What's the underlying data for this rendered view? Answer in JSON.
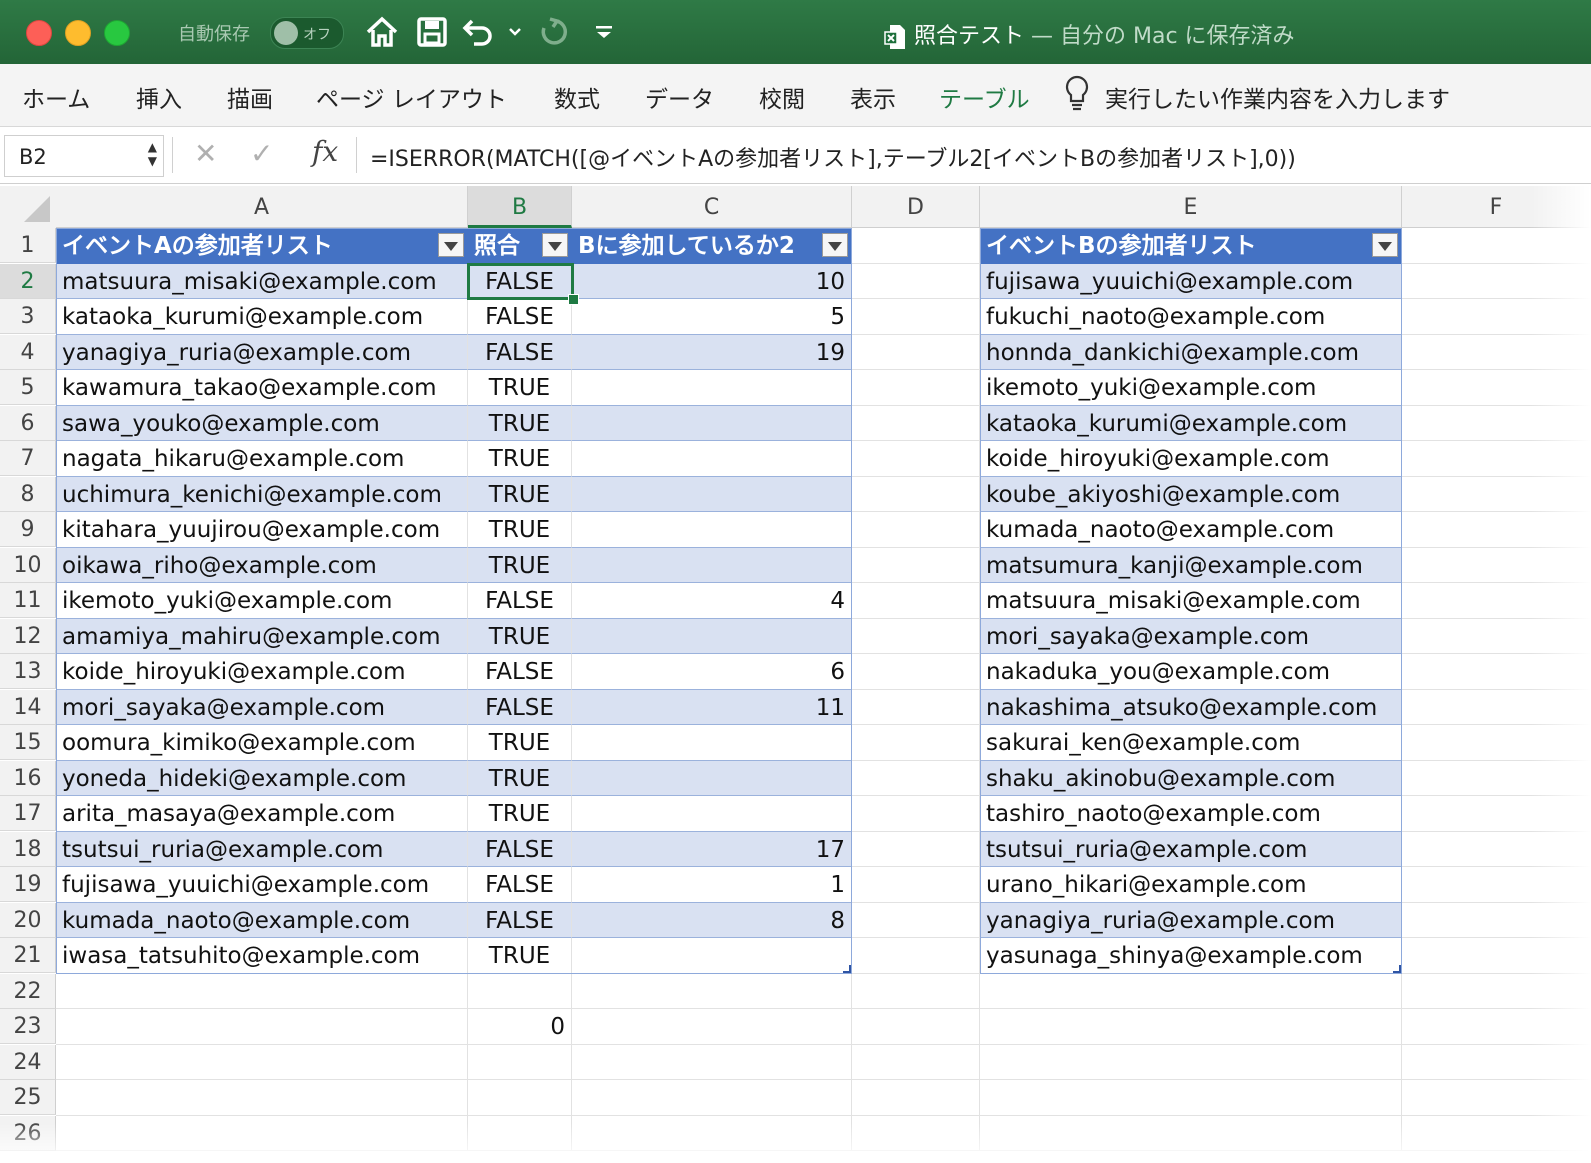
{
  "titlebar": {
    "autosave_label": "自動保存",
    "toggle_label": "オフ",
    "file_name": "照合テスト",
    "file_status": " — 自分の Mac に保存済み"
  },
  "ribbon": {
    "tabs": [
      "ホーム",
      "挿入",
      "描画",
      "ページ レイアウト",
      "数式",
      "データ",
      "校閲",
      "表示",
      "テーブル"
    ],
    "active_tab": "テーブル",
    "tell_me": "実行したい作業内容を入力します"
  },
  "formula_bar": {
    "name_box": "B2",
    "formula": "=ISERROR(MATCH([@イベントAの参加者リスト],テーブル2[イベントBの参加者リスト],0))"
  },
  "colors": {
    "excel_green": "#1f7a43",
    "table_header": "#4472c4",
    "table_band": "#d9e1f2"
  },
  "sheet": {
    "columns": [
      "A",
      "B",
      "C",
      "D",
      "E",
      "F"
    ],
    "selected_column": "B",
    "rows": [
      "1",
      "2",
      "3",
      "4",
      "5",
      "6",
      "7",
      "8",
      "9",
      "10",
      "11",
      "12",
      "13",
      "14",
      "15",
      "16",
      "17",
      "18",
      "19",
      "20",
      "21",
      "22",
      "23",
      "24",
      "25",
      "26"
    ],
    "selected_row": "2",
    "table1_headers": [
      "イベントAの参加者リスト",
      "照合",
      "Bに参加しているか2"
    ],
    "table2_header": "イベントBの参加者リスト",
    "colA": [
      "matsuura_misaki@example.com",
      "kataoka_kurumi@example.com",
      "yanagiya_ruria@example.com",
      "kawamura_takao@example.com",
      "sawa_youko@example.com",
      "nagata_hikaru@example.com",
      "uchimura_kenichi@example.com",
      "kitahara_yuujirou@example.com",
      "oikawa_riho@example.com",
      "ikemoto_yuki@example.com",
      "amamiya_mahiru@example.com",
      "koide_hiroyuki@example.com",
      "mori_sayaka@example.com",
      "oomura_kimiko@example.com",
      "yoneda_hideki@example.com",
      "arita_masaya@example.com",
      "tsutsui_ruria@example.com",
      "fujisawa_yuuichi@example.com",
      "kumada_naoto@example.com",
      "iwasa_tatsuhito@example.com"
    ],
    "colB": [
      "FALSE",
      "FALSE",
      "FALSE",
      "TRUE",
      "TRUE",
      "TRUE",
      "TRUE",
      "TRUE",
      "TRUE",
      "FALSE",
      "TRUE",
      "FALSE",
      "FALSE",
      "TRUE",
      "TRUE",
      "TRUE",
      "FALSE",
      "FALSE",
      "FALSE",
      "TRUE"
    ],
    "colC": [
      "10",
      "5",
      "19",
      "",
      "",
      "",
      "",
      "",
      "",
      "4",
      "",
      "6",
      "11",
      "",
      "",
      "",
      "17",
      "1",
      "8",
      ""
    ],
    "colE": [
      "fujisawa_yuuichi@example.com",
      "fukuchi_naoto@example.com",
      "honnda_dankichi@example.com",
      "ikemoto_yuki@example.com",
      "kataoka_kurumi@example.com",
      "koide_hiroyuki@example.com",
      "koube_akiyoshi@example.com",
      "kumada_naoto@example.com",
      "matsumura_kanji@example.com",
      "matsuura_misaki@example.com",
      "mori_sayaka@example.com",
      "nakaduka_you@example.com",
      "nakashima_atsuko@example.com",
      "sakurai_ken@example.com",
      "shaku_akinobu@example.com",
      "tashiro_naoto@example.com",
      "tsutsui_ruria@example.com",
      "urano_hikari@example.com",
      "yanagiya_ruria@example.com",
      "yasunaga_shinya@example.com"
    ],
    "b23": "0"
  }
}
